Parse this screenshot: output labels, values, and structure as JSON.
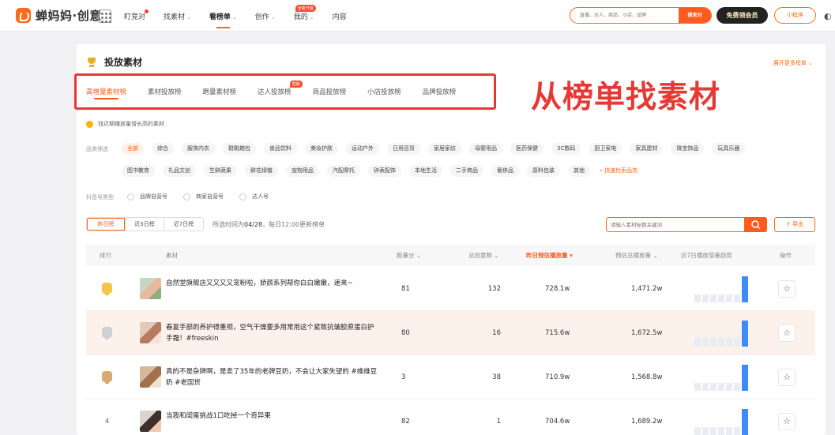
{
  "topnav": {
    "logo_text": "蝉妈妈·创意",
    "items": [
      {
        "label": "盯竞对",
        "dot": true,
        "caret": false
      },
      {
        "label": "找素材",
        "caret": true
      },
      {
        "label": "看榜单",
        "caret": true,
        "active": true
      },
      {
        "label": "创作",
        "caret": true
      },
      {
        "label": "我的",
        "caret": true,
        "badge": "全新升级"
      },
      {
        "label": "内容",
        "caret": false
      }
    ],
    "search_placeholder": "直播、达人、商品、小店、品牌",
    "search_button": "搜竞对",
    "vip_button": "免费领会员",
    "mini_program": "小程序"
  },
  "page": {
    "title": "投放素材",
    "expand_more": "展开更多榜单"
  },
  "tabs": [
    {
      "label": "高增量素材榜",
      "active": true
    },
    {
      "label": "素材投放榜"
    },
    {
      "label": "跑量素材榜"
    },
    {
      "label": "达人投放榜",
      "badge": "直播"
    },
    {
      "label": "商品投放榜"
    },
    {
      "label": "小店投放榜"
    },
    {
      "label": "品牌投放榜"
    }
  ],
  "overlay_label": "从榜单找素材",
  "hint": "找近期播放量增长高的素材",
  "category": {
    "label": "品类筛选",
    "row1": [
      "全部",
      "综合",
      "服饰内衣",
      "鞋靴箱包",
      "食品饮料",
      "美妆护肤",
      "运动户外",
      "日用百货",
      "家居家纺",
      "母婴用品",
      "医药保健",
      "3C数码",
      "厨卫家电",
      "家具建材",
      "珠宝饰品",
      "玩具乐器"
    ],
    "row2": [
      "图书教育",
      "礼品文创",
      "生鲜蔬果",
      "鲜花绿植",
      "宠物用品",
      "汽配摩托",
      "钟表配饰",
      "本地生活",
      "二手商品",
      "奢侈品",
      "原料包装",
      "其他"
    ],
    "quick_link": "快速检索品类"
  },
  "account_type": {
    "label": "抖音号类型",
    "options": [
      "品牌自营号",
      "商家自营号",
      "达人号"
    ]
  },
  "toolbar": {
    "ranges": [
      {
        "label": "昨日榜",
        "active": true
      },
      {
        "label": "近3日榜"
      },
      {
        "label": "近7日榜"
      }
    ],
    "update_prefix": "所选时间为",
    "update_date": "04/28",
    "update_suffix": "，每日12:00更新榜单",
    "search_placeholder": "请输入素材标题关键词",
    "export_label": "导出"
  },
  "table": {
    "headers": {
      "rank": "排行",
      "material": "素材",
      "run_score": "跑量分",
      "creative_count": "总创意数",
      "yesterday_plays": "昨日预估播放量",
      "total_plays": "预估总播放量",
      "trend": "近7日播放增量趋势",
      "action": "操作"
    },
    "rows": [
      {
        "rank": "1",
        "title": "自然堂旗舰店又又又又宠粉啦，娇颜系列帮你白白嫩嫩，速来~",
        "run_score": "81",
        "creative_count": "132",
        "yesterday_plays": "728.1w",
        "total_plays": "1,471.2w",
        "trend": [
          0.3,
          0.3,
          0.3,
          0.3,
          0.3,
          0.3,
          1.0
        ]
      },
      {
        "rank": "2",
        "title": "春夏手部的养护得重视，空气干燥要多用常用这个紧致抗皱胶原蛋白护手霜！#freeskin",
        "run_score": "80",
        "creative_count": "16",
        "yesterday_plays": "715.6w",
        "total_plays": "1,672.5w",
        "trend": [
          0.35,
          0.35,
          0.35,
          0.35,
          0.35,
          0.35,
          1.0
        ]
      },
      {
        "rank": "3",
        "title": "真的不是杂牌啊，是卖了35年的老牌豆奶，不会让大家失望的 #维维豆奶 #老国货",
        "run_score": "3",
        "creative_count": "38",
        "yesterday_plays": "710.9w",
        "total_plays": "1,568.8w",
        "trend": [
          0.3,
          0.3,
          0.3,
          0.3,
          0.3,
          0.3,
          1.0
        ]
      },
      {
        "rank": "4",
        "title": "当我和闺蜜挑战1口吃掉一个奇异果",
        "run_score": "82",
        "creative_count": "1",
        "yesterday_plays": "704.6w",
        "total_plays": "1,689.2w",
        "trend": [
          0.3,
          0.3,
          0.3,
          0.3,
          0.3,
          0.3,
          1.0
        ]
      }
    ]
  },
  "colors": {
    "accent": "#ff5a1f",
    "annotation_red": "#e53935",
    "trend_bar": "#3d8bff",
    "trend_muted": "#e9edf3"
  }
}
